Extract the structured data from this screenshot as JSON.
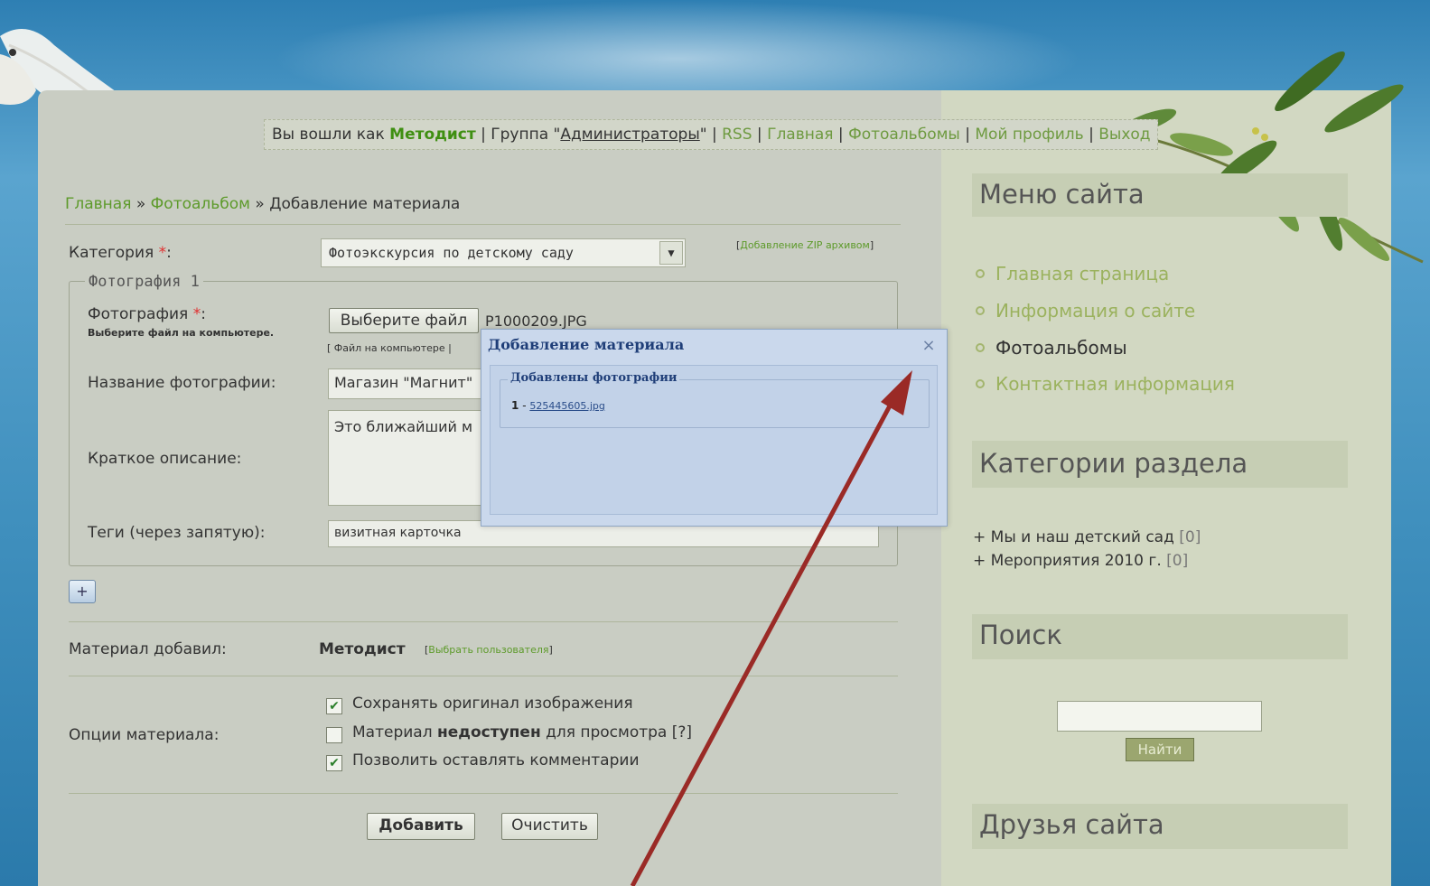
{
  "topnav": {
    "logged_as": "Вы вошли как",
    "user": "Методист",
    "group_prefix": "| Группа \"",
    "group": "Администраторы",
    "group_suffix": "\" |",
    "links": [
      "RSS",
      "Главная",
      "Фотоальбомы",
      "Мой профиль",
      "Выход"
    ]
  },
  "breadcrumb": {
    "home": "Главная",
    "sep": "»",
    "album": "Фотоальбом",
    "current": "Добавление материала"
  },
  "form": {
    "category_label": "Категория",
    "required_mark": "*",
    "colon": ":",
    "category_value": "Фотоэкскурсия по детскому саду",
    "zip_link": "Добавление ZIP архивом",
    "fieldset_legend": "Фотография 1",
    "photo_label": "Фотография",
    "photo_hint": "Выберите файл на компьютере.",
    "choose_file_button": "Выберите файл",
    "chosen_file": "P1000209.JPG",
    "file_source_link": "[ Файл на компьютере |",
    "title_label": "Название фотографии:",
    "title_value": "Магазин \"Магнит\"",
    "desc_label": "Краткое описание:",
    "desc_value": "Это ближайший м",
    "tags_label": "Теги (через запятую):",
    "tags_value": "визитная карточка",
    "add_photo_button": "+",
    "author_label": "Материал добавил:",
    "author_value": "Методист",
    "choose_user_link": "Выбрать пользователя",
    "options_label": "Опции материала:",
    "options": [
      {
        "label": "Сохранять оригинал изображения",
        "checked": true
      },
      {
        "label_pre": "Материал ",
        "label_bold": "недоступен",
        "label_post": " для просмотра [?]",
        "checked": false
      },
      {
        "label": "Позволить оставлять комментарии",
        "checked": true
      }
    ],
    "submit_button": "Добавить",
    "reset_button": "Очистить"
  },
  "sidebar": {
    "menu_title": "Меню сайта",
    "menu_items": [
      "Главная страница",
      "Информация о сайте",
      "Фотоальбомы",
      "Контактная информация"
    ],
    "categories_title": "Категории раздела",
    "categories": [
      {
        "name": "Мы и наш детский сад",
        "count": "[0]"
      },
      {
        "name": "Мероприятия 2010 г.",
        "count": "[0]"
      }
    ],
    "search_title": "Поиск",
    "search_button": "Найти",
    "friends_title": "Друзья сайта"
  },
  "modal": {
    "title": "Добавление материала",
    "close": "×",
    "legend": "Добавлены фотографии",
    "file_index": "1",
    "file_dash": "-",
    "file_name": "525445605.jpg"
  },
  "colors": {
    "link_green": "#5d9a2a",
    "modal_title": "#1f3e78",
    "arrow": "#9a2a26"
  },
  "icons": {
    "dropdown": "chevron-down-icon",
    "close": "close-icon",
    "check": "check-icon",
    "bullet": "circle-bullet-icon"
  }
}
